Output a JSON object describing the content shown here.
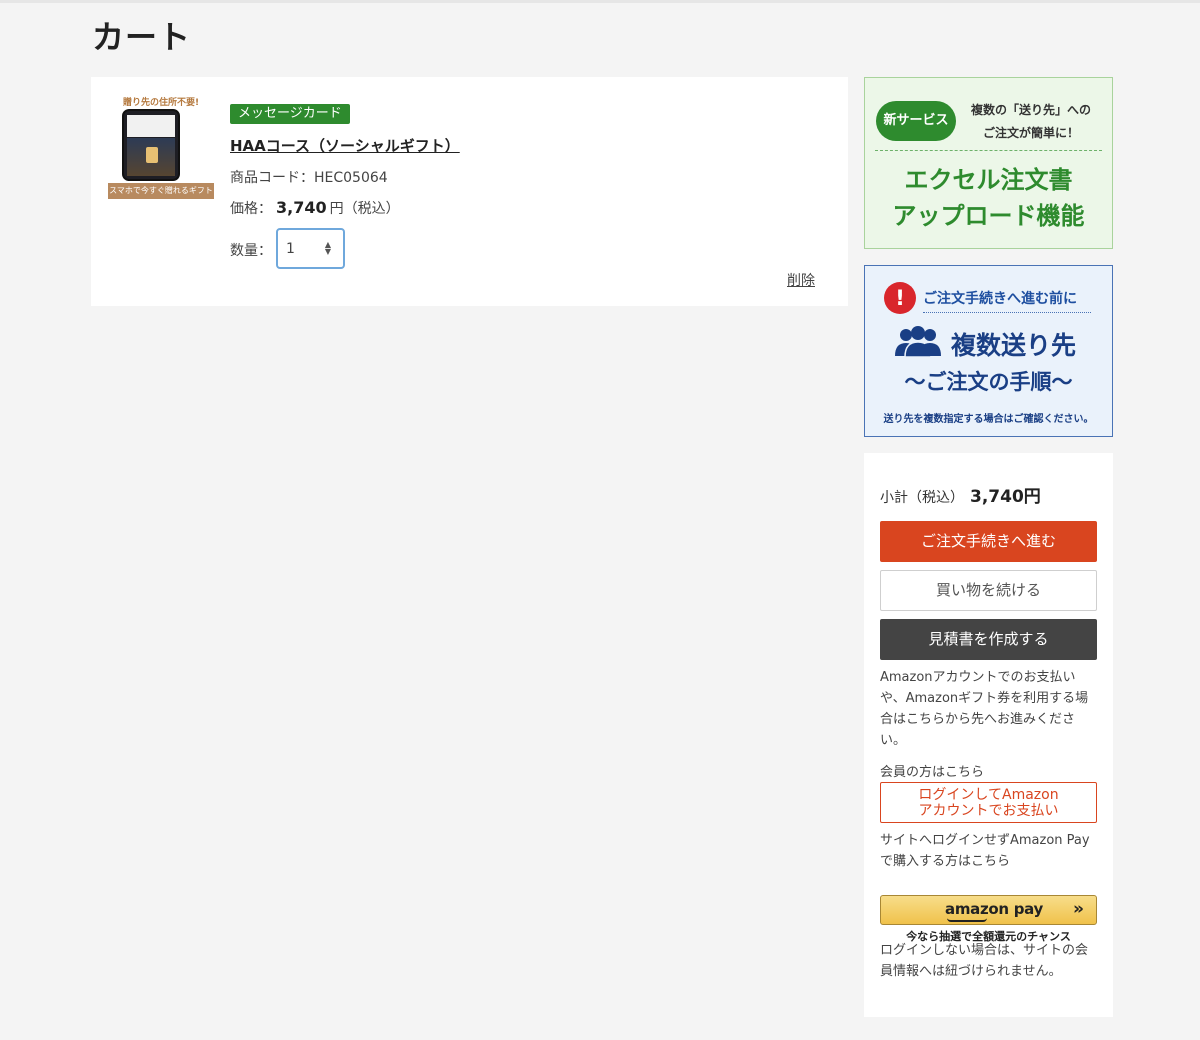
{
  "page": {
    "title": "カート"
  },
  "cart": {
    "item": {
      "thumb_top_text": "贈り先の住所不要!",
      "thumb_bottom_text": "スマホで今すぐ贈れるギフト",
      "badge": "メッセージカード",
      "name": "HAAコース（ソーシャルギフト）",
      "code_label": "商品コード：",
      "code": "HEC05064",
      "price_label": "価格：",
      "price": "3,740",
      "price_unit": "円（税込）",
      "qty_label": "数量：",
      "qty": "1"
    },
    "delete_label": "削除"
  },
  "banners": {
    "excel": {
      "pill": "新サービス",
      "sub_line1": "複数の「送り先」への",
      "sub_line2": "ご注文が簡単に！",
      "title_line1": "エクセル注文書",
      "title_line2": "アップロード機能"
    },
    "multi": {
      "sub": "ご注文手続きへ進む前に",
      "title_line1": "複数送り先",
      "title_line2": "〜ご注文の手順〜",
      "note": "送り先を複数指定する場合はご確認ください。"
    }
  },
  "summary": {
    "subtotal_label": "小計（税込）",
    "subtotal_value": "3,740円",
    "checkout_label": "ご注文手続きへ進む",
    "continue_label": "買い物を続ける",
    "quote_label": "見積書を作成する",
    "amazon_note": "Amazonアカウントでのお支払いや、Amazonギフト券を利用する場合はこちらから先へお進みください。",
    "member_label": "会員の方はこちら",
    "login_amazon_line1": "ログインしてAmazon",
    "login_amazon_line2": "アカウントでお支払い",
    "guest_note": "サイトへログインせずAmazon Payで購入する方はこちら",
    "amazon_pay_logo": "amazon pay",
    "chance_text": "今なら抽選で全額還元のチャンス",
    "login_disclaimer": "ログインしない場合は、サイトの会員情報へは紐づけられません。"
  },
  "colors": {
    "accent_orange": "#d9451f",
    "green": "#2e8b2e",
    "navy": "#1a3f85",
    "dark_button": "#444444",
    "amazon_yellow": "#f0c24b"
  },
  "icons": [
    "warning-icon",
    "people-icon",
    "spinner-arrows-icon",
    "chevron-double-right-icon"
  ]
}
